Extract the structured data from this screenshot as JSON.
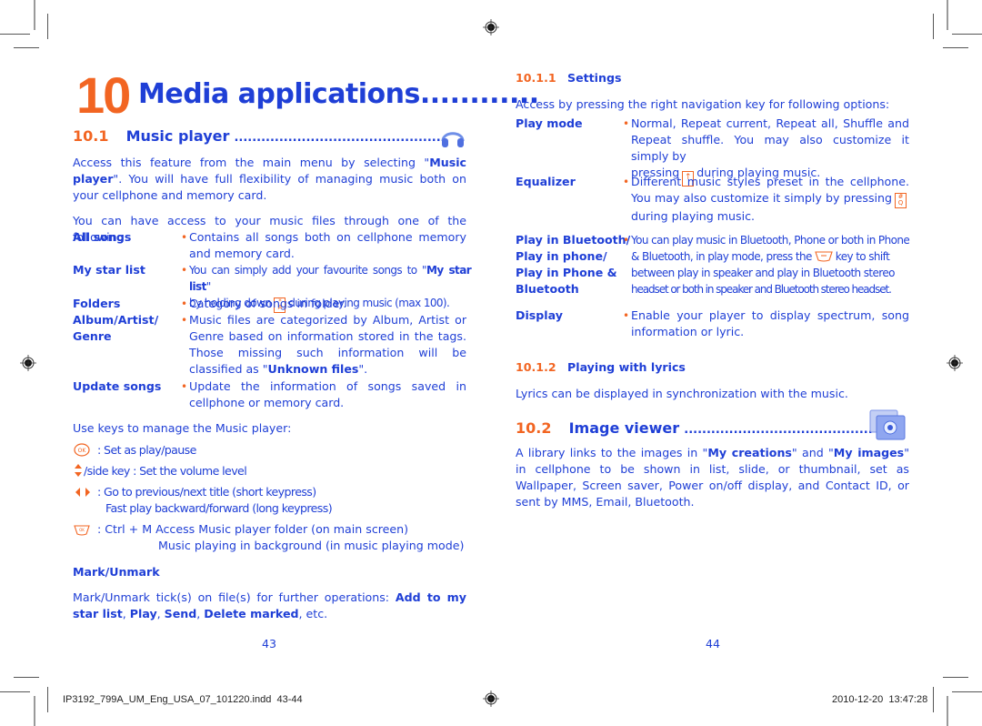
{
  "chapter": {
    "number": "10",
    "title": "Media applications",
    "leader": "............"
  },
  "left_page": {
    "section_music": {
      "number": "10.1",
      "title": "Music player",
      "leader": "..............................................",
      "icon": "headphones-icon"
    },
    "intro_1": {
      "before": "Access this feature from the main menu by selecting \"",
      "bold": "Music player",
      "after": "\". You will have full flexibility of managing music both on your cellphone and memory card."
    },
    "intro_2": "You can have access to your music files through one of the following:",
    "items": [
      {
        "label": "All songs",
        "text": "Contains all songs both on cellphone memory and memory card."
      },
      {
        "label": "My star list",
        "text_before": "You can simply add your favourite songs to \"",
        "text_bold": "My star list",
        "text_after": "\"",
        "line2_before": "by holding down",
        "key": "star-key",
        "key_glyph_top": "*",
        "key_glyph_bottom": "A",
        "line2_after": "during playing music (max 100)."
      },
      {
        "label": "Folders",
        "text": "Category of songs in folder."
      },
      {
        "label_line1": "Album/Artist/",
        "label_line2": "Genre",
        "text_before": "Music files are categorized by Album, Artist or Genre based on information stored in the tags. Those missing such information will be classified as \"",
        "text_bold": "Unknown files",
        "text_after": "\"."
      },
      {
        "label": "Update songs",
        "text": "Update the information of songs saved in cellphone or memory card."
      }
    ],
    "keys_intro": "Use keys to manage the Music player:",
    "keys": [
      {
        "icon": "ok-key-icon",
        "text": ": Set as play/pause"
      },
      {
        "icon": "up-down-key-icon",
        "text": "/side key : Set the volume level"
      },
      {
        "icon": "left-right-key-icon",
        "text": ": Go to previous/next title (short keypress)",
        "text2": "Fast play backward/forward (long keypress)"
      },
      {
        "icon": "message-key-icon",
        "text": ": Ctrl + M Access Music player folder (on main screen)",
        "text2": "Music playing in background (in music playing mode)"
      }
    ],
    "mark_heading": "Mark/Unmark",
    "mark_text": {
      "before": "Mark/Unmark tick(s) on file(s) for further operations: ",
      "b1": "Add to my star list",
      "s1": ", ",
      "b2": "Play",
      "s2": ", ",
      "b3": "Send",
      "s3": ", ",
      "b4": "Delete marked",
      "after": ", etc."
    },
    "page_number": "43"
  },
  "right_page": {
    "settings": {
      "number": "10.1.1",
      "title": "Settings"
    },
    "settings_intro": "Access by pressing the right navigation key for following options:",
    "options": [
      {
        "label": "Play mode",
        "text": "Normal, Repeat current, Repeat all, Shuffle and Repeat shuffle. You may also customize it simply by",
        "line3_before": "pressing",
        "key": "up-key",
        "line3_after": "during playing music."
      },
      {
        "label": "Equalizer",
        "text": "Different music styles preset in the cellphone. You may also customize it simply by pressing",
        "key": "hash-key",
        "after": "during playing music."
      },
      {
        "label_lines": [
          "Play in Bluetooth/",
          "Play in phone/",
          "Play in Phone &",
          "Bluetooth"
        ],
        "line1": "You can play music in Bluetooth, Phone or both in Phone",
        "line2_before": "& Bluetooth, in play mode, press the",
        "key": "caps-key",
        "line2_after": "key to shift",
        "line3": "between play in speaker and play in Bluetooth stereo",
        "line4": "headset or both in speaker and Bluetooth stereo headset."
      },
      {
        "label": "Display",
        "text": "Enable your player to display spectrum, song information or lyric."
      }
    ],
    "lyrics": {
      "number": "10.1.2",
      "title": "Playing with lyrics"
    },
    "lyrics_text": "Lyrics can be displayed in synchronization with the music.",
    "section_image": {
      "number": "10.2",
      "title": "Image viewer",
      "leader": "..........................................",
      "icon": "image-viewer-icon"
    },
    "image_text": {
      "before": "A library links to the images in \"",
      "b1": "My creations",
      "mid": "\" and \"",
      "b2": "My images",
      "after": "\" in cellphone to be shown in list, slide, or thumbnail, set as Wallpaper, Screen saver, Power on/off display, and Contact ID, or sent by MMS, Email, Bluetooth."
    },
    "page_number": "44"
  },
  "footer": {
    "filename": "IP3192_799A_UM_Eng_USA_07_101220.indd",
    "pages": "43-44",
    "date": "2010-12-20",
    "time": "13:47:28"
  },
  "colors": {
    "accent_blue": "#1f3fd6",
    "accent_orange": "#f26522"
  }
}
